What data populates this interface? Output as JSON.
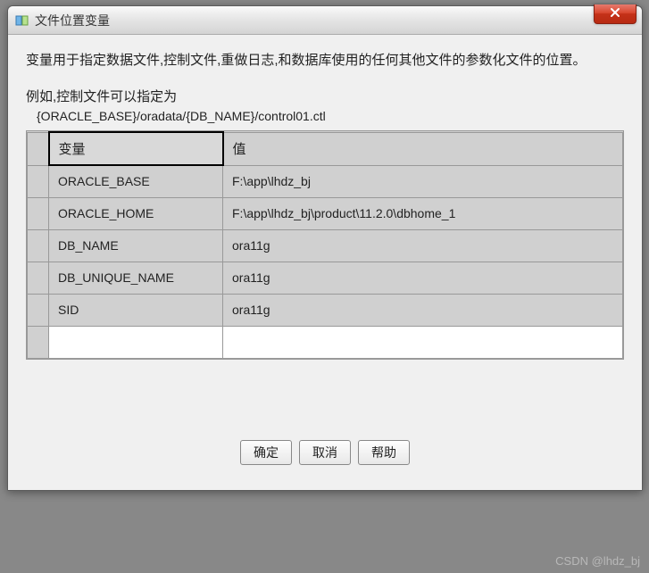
{
  "window": {
    "title": "文件位置变量"
  },
  "description": {
    "para1": "变量用于指定数据文件,控制文件,重做日志,和数据库使用的任何其他文件的参数化文件的位置。",
    "para2": "例如,控制文件可以指定为",
    "example": "{ORACLE_BASE}/oradata/{DB_NAME}/control01.ctl"
  },
  "table": {
    "headers": {
      "var": "变量",
      "val": "值"
    },
    "rows": [
      {
        "var": "ORACLE_BASE",
        "val": "F:\\app\\lhdz_bj"
      },
      {
        "var": "ORACLE_HOME",
        "val": "F:\\app\\lhdz_bj\\product\\11.2.0\\dbhome_1"
      },
      {
        "var": "DB_NAME",
        "val": "ora11g"
      },
      {
        "var": "DB_UNIQUE_NAME",
        "val": "ora11g"
      },
      {
        "var": "SID",
        "val": "ora11g"
      }
    ]
  },
  "buttons": {
    "ok": "确定",
    "cancel": "取消",
    "help": "帮助"
  },
  "watermark": "CSDN @lhdz_bj"
}
